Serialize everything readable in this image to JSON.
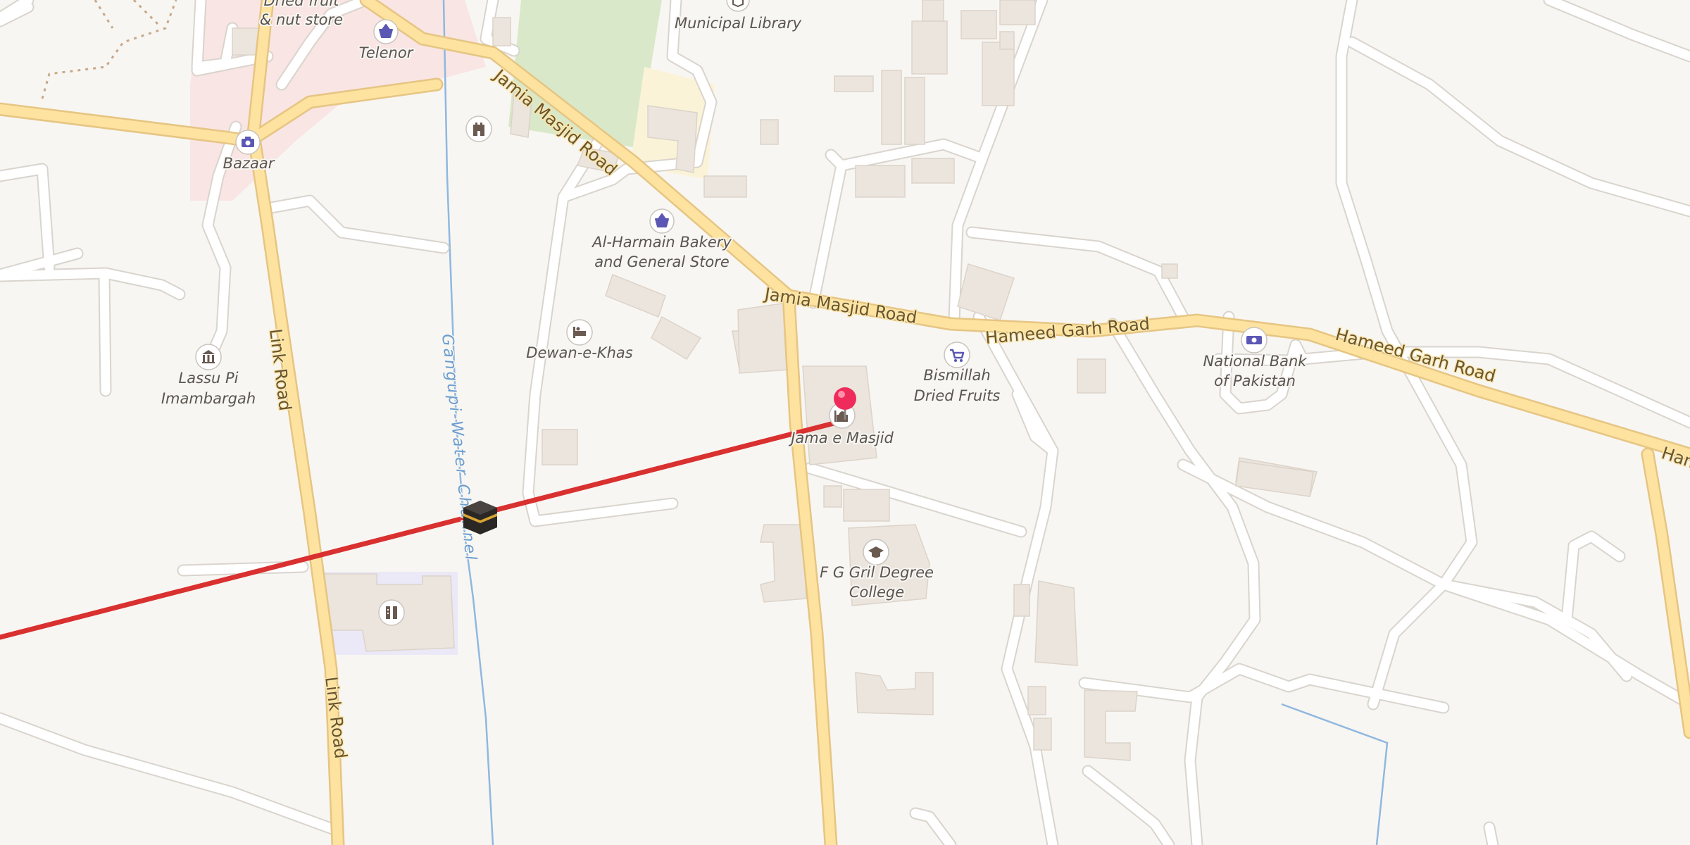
{
  "map": {
    "roads": {
      "jamia_masjid_1": "Jamia Masjid Road",
      "jamia_masjid_2": "Jamia Masjid Road",
      "hameed_garh_1": "Hameed Garh Road",
      "hameed_garh_2": "Hameed Garh Road",
      "hameed_garh_3": "Ham",
      "link_road_1": "Link Road",
      "link_road_2": "Link Road"
    },
    "waterway": "Gangupi-Water Channel",
    "places": {
      "dried_fruit_1": "Dried fruit",
      "dried_fruit_2": "& nut store",
      "telenor": "Telenor",
      "bazaar": "Bazaar",
      "municipal_library": "Municipal Library",
      "al_harmain_1": "Al-Harmain Bakery",
      "al_harmain_2": "and General Store",
      "dewan_e_khas": "Dewan-e-Khas",
      "lassu_pi_1": "Lassu Pi",
      "lassu_pi_2": "Imambargah",
      "bismillah_1": "Bismillah",
      "bismillah_2": "Dried Fruits",
      "national_bank_1": "National Bank",
      "national_bank_2": "of Pakistan",
      "jama_masjid": "Jama e Masjid",
      "fg_college_1": "F G Gril Degree",
      "fg_college_2": "College"
    },
    "icons": {
      "shop": "shopping-basket-icon",
      "camera": "camera-icon",
      "library": "book-icon",
      "castle": "castle-icon",
      "hotel": "bed-icon",
      "shrine": "museum-icon",
      "cart": "shopping-cart-icon",
      "bank": "banknote-icon",
      "mosque": "mosque-icon",
      "college": "graduation-cap-icon",
      "school": "school-icon",
      "kaaba": "kaaba-icon",
      "pin": "location-pin-icon"
    },
    "colors": {
      "background": "#f8f6f2",
      "major_road": "#fde39f",
      "minor_road": "#ffffff",
      "park": "#d9e8c8",
      "commercial": "#f9e5e3",
      "school_area": "#fbf3d8",
      "water": "#8fb8e0",
      "qibla_line": "#d93030",
      "pin": "#ee2b5b",
      "poi_icon": "#5b57b5"
    }
  }
}
